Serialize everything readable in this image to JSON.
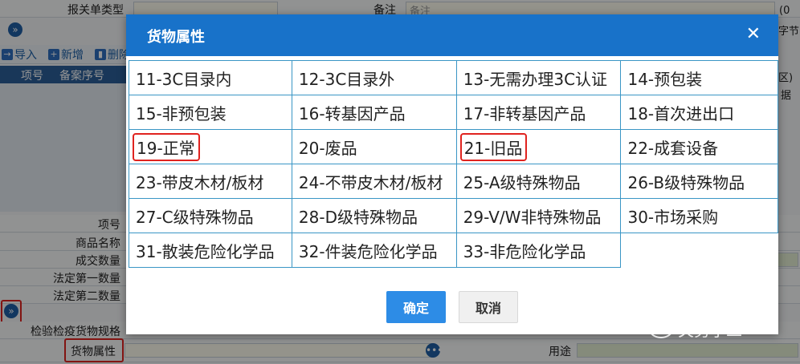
{
  "background": {
    "top_fields": [
      {
        "label": "报关单类型",
        "value": ""
      },
      {
        "label": "备注",
        "value": "备注"
      }
    ],
    "toolbar": {
      "import_label": "导入",
      "new_label": "新增",
      "delete_label": "删除"
    },
    "grid_columns": [
      "项号",
      "备案序号"
    ],
    "right_fragments": {
      "top": "(0",
      "char_count": "字节",
      "region": "区)",
      "data": "据"
    },
    "form_labels": [
      "项号",
      "商品名称",
      "成交数量",
      "法定第一数量",
      "法定第二数量",
      "检验检疫货物规格",
      "货物属性"
    ],
    "usage_label": "用途",
    "accent_blue": "#1872c9"
  },
  "dialog": {
    "title": "货物属性",
    "close_icon": "close-icon",
    "options": [
      [
        "11-3C目录内",
        "12-3C目录外",
        "13-无需办理3C认证",
        "14-预包装"
      ],
      [
        "15-非预包装",
        "16-转基因产品",
        "17-非转基因产品",
        "18-首次进出口"
      ],
      [
        "19-正常",
        "20-废品",
        "21-旧品",
        "22-成套设备"
      ],
      [
        "23-带皮木材/板材",
        "24-不带皮木材/板材",
        "25-A级特殊物品",
        "26-B级特殊物品"
      ],
      [
        "27-C级特殊物品",
        "28-D级特殊物品",
        "29-V/W非特殊物品",
        "30-市场采购"
      ],
      [
        "31-散装危险化学品",
        "32-件装危险化学品",
        "33-非危险化学品",
        ""
      ]
    ],
    "highlighted": [
      "19-正常",
      "21-旧品"
    ],
    "highlight_color": "#e0231f",
    "confirm_label": "确定",
    "cancel_label": "取消"
  },
  "watermark": {
    "text": "关务小二"
  }
}
